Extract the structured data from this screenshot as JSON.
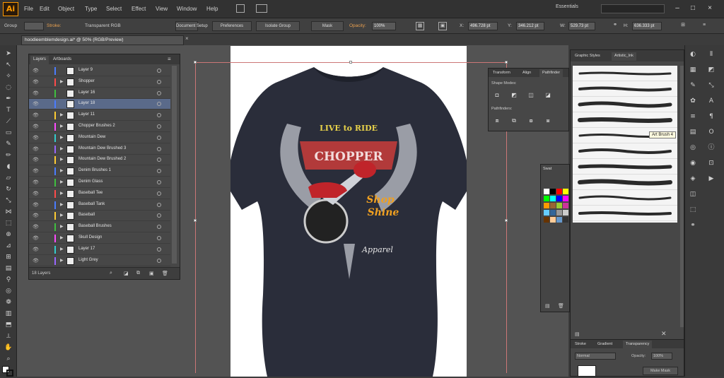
{
  "app": {
    "logo": "Ai"
  },
  "menu": [
    "File",
    "Edit",
    "Object",
    "Type",
    "Select",
    "Effect",
    "View",
    "Window",
    "Help"
  ],
  "workspace": "Essentials",
  "control_bar": {
    "selection": "Group",
    "stroke_label": "Stroke:",
    "opacity_label": "Opacity:",
    "opacity_value": "100%",
    "style_label": "Transparent RGB",
    "doc_setup": "Document Setup",
    "preferences": "Preferences",
    "isolate": "Isolate Group",
    "mask": "Mask",
    "x_value": "496.728 pt",
    "y_value": "346.212 pt",
    "w_value": "529.73 pt",
    "h_value": "636.333 pt"
  },
  "document_tab": {
    "title": "hoodieemblemdesign.ai* @ 50% (RGB/Preview)",
    "close": "×"
  },
  "layers_panel": {
    "tabs": [
      "Layers",
      "Artboards"
    ],
    "layers": [
      {
        "name": "Layer 9",
        "color": "#4a7cff",
        "selected": false,
        "expandable": false
      },
      {
        "name": "Shopper",
        "color": "#ff4a4a",
        "selected": false,
        "expandable": true
      },
      {
        "name": "Layer 16",
        "color": "#3fbf3f",
        "selected": false,
        "expandable": false
      },
      {
        "name": "Layer 18",
        "color": "#4a7cff",
        "selected": true,
        "expandable": false
      },
      {
        "name": "Layer 11",
        "color": "#ffcc33",
        "selected": false,
        "expandable": true
      },
      {
        "name": "Chopper Brushes 2",
        "color": "#ff4aff",
        "selected": false,
        "expandable": true
      },
      {
        "name": "Mountain Dew",
        "color": "#33cccc",
        "selected": false,
        "expandable": true
      },
      {
        "name": "Mountain Dew Brushed 3",
        "color": "#9966ff",
        "selected": false,
        "expandable": true
      },
      {
        "name": "Mountain Dew Brushed 2",
        "color": "#ffcc33",
        "selected": false,
        "expandable": true
      },
      {
        "name": "Denim Brushes 1",
        "color": "#4a7cff",
        "selected": false,
        "expandable": true
      },
      {
        "name": "Denim Glass",
        "color": "#3fbf3f",
        "selected": false,
        "expandable": true
      },
      {
        "name": "Baseball Tee",
        "color": "#ff4a4a",
        "selected": false,
        "expandable": true
      },
      {
        "name": "Baseball Tank",
        "color": "#4a7cff",
        "selected": false,
        "expandable": true
      },
      {
        "name": "Baseball",
        "color": "#ffcc33",
        "selected": false,
        "expandable": true
      },
      {
        "name": "Baseball Brushes",
        "color": "#3fbf3f",
        "selected": false,
        "expandable": true
      },
      {
        "name": "Skull Design",
        "color": "#ff4aff",
        "selected": false,
        "expandable": true
      },
      {
        "name": "Layer 17",
        "color": "#33cccc",
        "selected": false,
        "expandable": true
      },
      {
        "name": "Light Grey",
        "color": "#9966ff",
        "selected": false,
        "expandable": true
      }
    ],
    "footer_count": "18 Layers"
  },
  "pathfinder_panel": {
    "tabs": [
      "Transform",
      "Align",
      "Pathfinder"
    ],
    "shape_modes_label": "Shape Modes:",
    "pathfinders_label": "Pathfinders:"
  },
  "swatches_panel": {
    "tab": "Swat",
    "colors": [
      "#ffffff",
      "#000000",
      "#ff0000",
      "#ffff00",
      "#00ff00",
      "#00ffff",
      "#0000ff",
      "#ff00ff",
      "#ff9900",
      "#996633",
      "#99cc33",
      "#cc3399",
      "#66ccff",
      "#336699",
      "#999999",
      "#cccccc",
      "#663300",
      "#ffcc99",
      "#6699cc",
      "#333333"
    ]
  },
  "brushes_panel": {
    "tabs": [
      "Graphic Styles",
      "Artistic_Ink"
    ],
    "tooltip": "Art Brush 4",
    "brush_count": 10
  },
  "transparency_panel": {
    "tabs": [
      "Stroke",
      "Gradient",
      "Transparency"
    ],
    "mode": "Normal",
    "opacity_label": "Opacity:",
    "opacity_value": "100%",
    "make_mask": "Make Mask"
  },
  "artwork": {
    "banner_top": "LIVE to RIDE",
    "banner_main": "CHOPPER",
    "script_text": "Shop",
    "script_text2": "Shine",
    "bottom_text": "Apparel",
    "shirt_color": "#2a2d3a"
  }
}
